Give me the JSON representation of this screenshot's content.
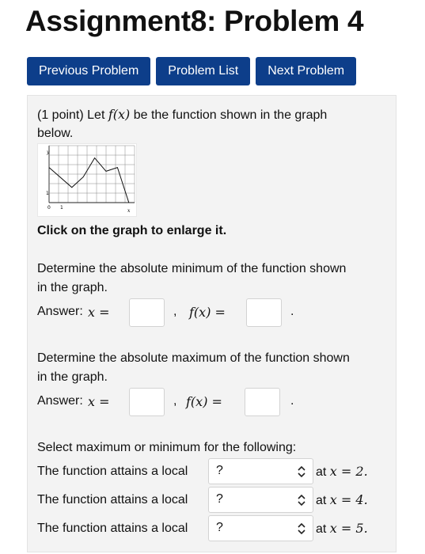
{
  "title": "Assignment8: Problem 4",
  "nav": {
    "previous": "Previous Problem",
    "list": "Problem List",
    "next": "Next Problem"
  },
  "intro": {
    "line1_prefix": "(1 point) Let ",
    "line1_fx": "f(x)",
    "line1_suffix": " be the function shown in the graph",
    "line2": "below."
  },
  "graph": {
    "y_label": "y",
    "x_label": "x",
    "tick_0": "0",
    "tick_1": "1",
    "tick_y1": "1",
    "function_points": [
      [
        0,
        3.7
      ],
      [
        2,
        1.6
      ],
      [
        3,
        2.7
      ],
      [
        4,
        4.7
      ],
      [
        5,
        3.3
      ],
      [
        6,
        3.7
      ],
      [
        7,
        0
      ]
    ],
    "x_range": [
      0,
      7
    ],
    "y_range": [
      0,
      5
    ]
  },
  "enlarge_text": "Click on the graph to enlarge it.",
  "q1": {
    "line1": "Determine the absolute minimum of the function shown",
    "line2": "in the graph.",
    "answer_label": "Answer: ",
    "x_eq": "x =",
    "comma": ",",
    "fx_eq": "f(x) =",
    "period": "."
  },
  "q2": {
    "line1": "Determine the absolute maximum of the function shown",
    "line2": "in the graph.",
    "answer_label": "Answer: ",
    "x_eq": "x =",
    "comma": ",",
    "fx_eq": "f(x) =",
    "period": "."
  },
  "q3": {
    "prompt": "Select maximum or minimum for the following:",
    "rows": [
      {
        "label": "The function attains a local",
        "selected": "?",
        "at_text": "at ",
        "x_val": "x = 2."
      },
      {
        "label": "The function attains a local",
        "selected": "?",
        "at_text": "at ",
        "x_val": "x = 4."
      },
      {
        "label": "The function attains a local",
        "selected": "?",
        "at_text": "at ",
        "x_val": "x = 5."
      }
    ]
  }
}
